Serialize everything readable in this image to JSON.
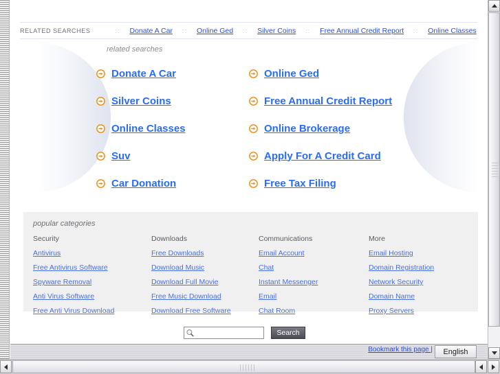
{
  "top_bar": {
    "label": "RELATED SEARCHES",
    "separator": "::",
    "links": [
      "Donate A Car",
      "Online Ged",
      "Silver Coins",
      "Free Annual Credit Report",
      "Online Classes"
    ]
  },
  "related_searches": {
    "title": "related searches",
    "items": [
      "Donate A Car",
      "Online Ged",
      "Silver Coins",
      "Free Annual Credit Report",
      "Online Classes",
      "Online Brokerage",
      "Suv",
      "Apply For A Credit Card",
      "Car Donation",
      "Free Tax Filing"
    ]
  },
  "popular_categories": {
    "title": "popular categories",
    "columns": [
      {
        "heading": "Security",
        "links": [
          "Antivirus",
          "Free Antivirus Software",
          "Spyware Removal",
          "Anti Virus Software",
          "Free Anti Virus Download"
        ]
      },
      {
        "heading": "Downloads",
        "links": [
          "Free Downloads",
          "Download Music",
          "Download Full Movie",
          "Free Music Download",
          "Download Free Software"
        ]
      },
      {
        "heading": "Communications",
        "links": [
          "Email Account",
          "Chat",
          "Instant Messenger",
          "Email",
          "Chat Room"
        ]
      },
      {
        "heading": "More",
        "links": [
          "Email Hosting",
          "Domain Registration",
          "Network Security",
          "Domain Name",
          "Proxy Servers"
        ]
      }
    ]
  },
  "search": {
    "value": "",
    "placeholder": "",
    "button_label": "Search",
    "icon": "magnifier-icon"
  },
  "status_bar": {
    "bookmark_label": "Bookmark this page |",
    "language": "English"
  },
  "colors": {
    "link_blue": "#2a6df4",
    "small_link_blue": "#4a6fe0",
    "arrow_orange": "#f08a00",
    "panel_gray": "#f0f0f0"
  }
}
